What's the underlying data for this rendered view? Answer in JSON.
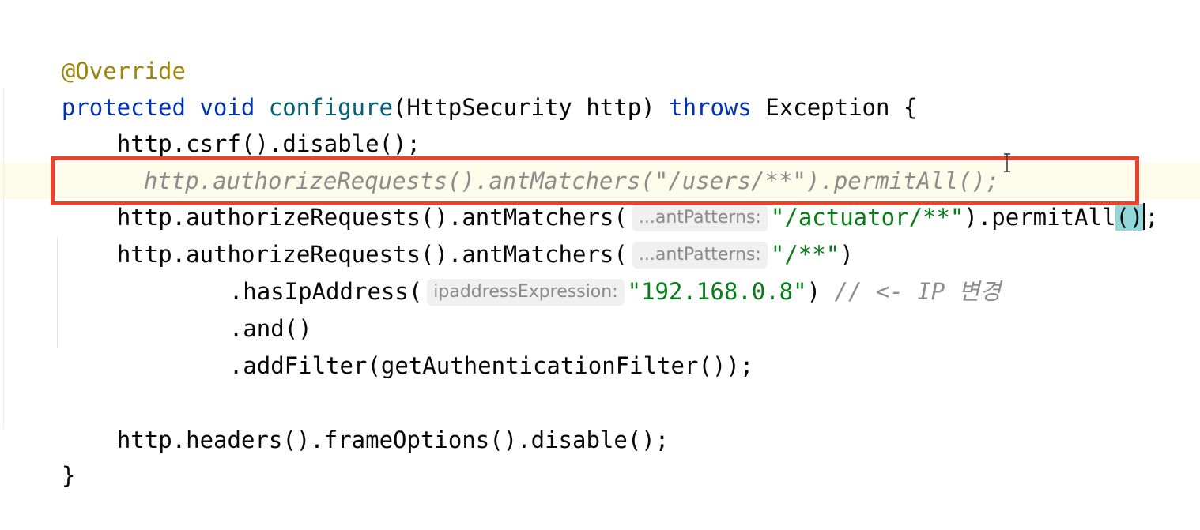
{
  "editor": {
    "annotation": "@Override",
    "signature": {
      "kw_protected": "protected",
      "kw_void": "void",
      "method": "configure",
      "params": "(HttpSecurity http) ",
      "kw_throws": "throws",
      "rest": " Exception {"
    },
    "line_csrf": "http.csrf().disable();",
    "line_commented": "http.authorizeRequests().antMatchers(\"/users/**\").permitAll();",
    "line_active": {
      "prefix": "http.authorizeRequests().antMatchers(",
      "hint": "...antPatterns:",
      "string": "\"/actuator/**\"",
      "suffix_a": ").permitAll",
      "paren": "()",
      "suffix_b": ";"
    },
    "line_next": {
      "prefix": "http.authorizeRequests().antMatchers(",
      "hint": "...antPatterns:",
      "string": "\"/**\"",
      "suffix": ")"
    },
    "line_ip": {
      "prefix": ".hasIpAddress(",
      "hint": "ipaddressExpression:",
      "string": "\"192.168.0.8\"",
      "suffix": ") ",
      "comment": "// <- IP 변경"
    },
    "line_and": ".and()",
    "line_filter": ".addFilter(getAuthenticationFilter());",
    "line_headers": "http.headers().frameOptions().disable();",
    "closing": "}"
  },
  "colors": {
    "keyword": "#0033b3",
    "method": "#00627a",
    "annotation": "#9e880d",
    "string": "#067d17",
    "comment": "#8c8c8c",
    "highlight_box": "#e8432c"
  }
}
